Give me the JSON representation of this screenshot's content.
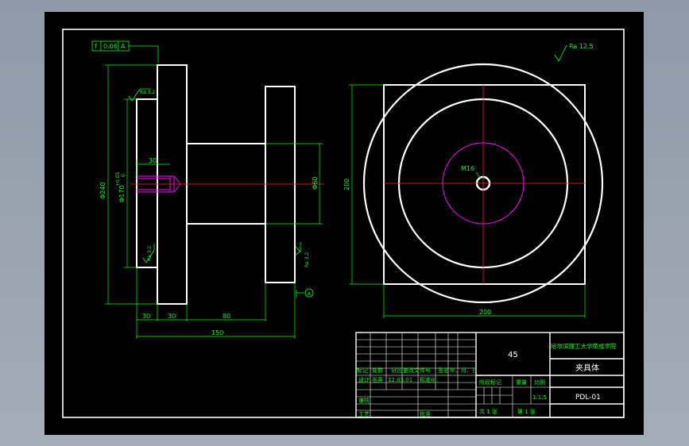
{
  "drawing": {
    "side_view": {
      "feature_control": {
        "symbol": "f",
        "tolerance": "0.06",
        "datum": "A"
      },
      "dimensions": {
        "outer_diameter": "Φ240",
        "bore_diameter": "Φ170",
        "bore_tol_upper": "+0.05",
        "bore_tol_lower": "0",
        "boss_diameter": "Φ60",
        "thread_depth": "30",
        "thickness_1": "30",
        "thickness_2": "30",
        "neck_length": "80",
        "overall_length": "150"
      },
      "roughness": [
        "Ra 3.2",
        "Ra 3.2",
        "Ra 3.2"
      ],
      "datum_label": "A"
    },
    "front_view": {
      "roughness_general": "Ra 12.5",
      "center_hole": "M16",
      "dim_height": "200",
      "dim_width": "200"
    },
    "title_block": {
      "material": "45",
      "school": "哈尔滨理工大学荣成学院",
      "part_name": "夹具体",
      "drawing_number": "PDL-01",
      "scale_label": "比例",
      "scale_value": "1:1.5",
      "weight_label": "重量",
      "stage_label": "阶段标记",
      "sheets_total": "共 1 张",
      "sheet_current": "第 1 张",
      "revision_headers": [
        "标记",
        "处数",
        "分区",
        "更改文件号",
        "签名",
        "年、月、日"
      ],
      "design_label": "设计",
      "designer": "张英",
      "date": "12.03.01",
      "standard_label": "标准化",
      "review_label": "审核",
      "process_label": "工艺",
      "approve_label": "批准"
    }
  }
}
